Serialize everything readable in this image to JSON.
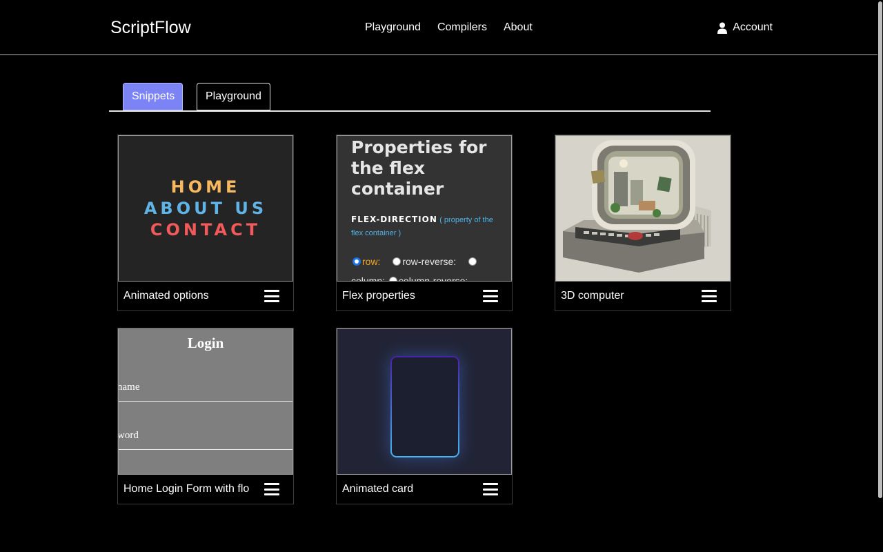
{
  "header": {
    "brand": "ScriptFlow",
    "nav": [
      "Playground",
      "Compilers",
      "About"
    ],
    "account_label": "Account"
  },
  "tabs": [
    {
      "label": "Snippets",
      "active": true
    },
    {
      "label": "Playground",
      "active": false
    }
  ],
  "cards": [
    {
      "title": "Animated options"
    },
    {
      "title": "Flex properties"
    },
    {
      "title": "3D computer"
    },
    {
      "title": "Home Login Form with flo"
    },
    {
      "title": "Animated card"
    }
  ],
  "previews": {
    "animated_options": {
      "items": [
        "HOME",
        "ABOUT US",
        "CONTACT"
      ],
      "colors": [
        "#f7b860",
        "#5fb3e6",
        "#f15a5a"
      ]
    },
    "flex": {
      "heading": "Properties for the flex container",
      "prop_name": "FLEX-DIRECTION",
      "prop_note": "( property of the flex container )",
      "options": [
        "row:",
        "row-reverse:",
        "column:",
        "column-reverse:"
      ]
    },
    "login": {
      "title": "Login",
      "field1": "name",
      "field2": "word"
    }
  },
  "colors": {
    "tab_active": "#7b83f5",
    "background": "#000000"
  },
  "icons": [
    "user-icon",
    "menu-icon"
  ]
}
